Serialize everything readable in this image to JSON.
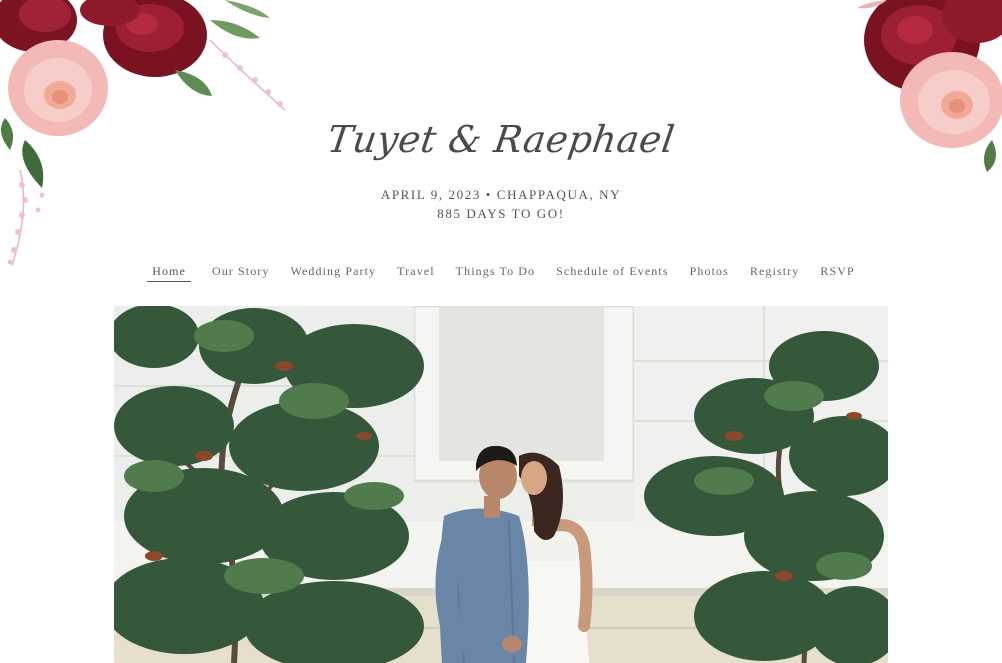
{
  "header": {
    "couple_names": "Tuyet & Raephael",
    "date_location": "APRIL 9, 2023 • CHAPPAQUA, NY",
    "countdown": "885 DAYS TO GO!"
  },
  "nav": {
    "items": [
      {
        "label": "Home",
        "active": true
      },
      {
        "label": "Our Story",
        "active": false
      },
      {
        "label": "Wedding Party",
        "active": false
      },
      {
        "label": "Travel",
        "active": false
      },
      {
        "label": "Things To Do",
        "active": false
      },
      {
        "label": "Schedule of Events",
        "active": false
      },
      {
        "label": "Photos",
        "active": false
      },
      {
        "label": "Registry",
        "active": false
      },
      {
        "label": "RSVP",
        "active": false
      }
    ]
  },
  "decor": {
    "left": "floral-corner-bouquet",
    "right": "floral-corner-bouquet"
  },
  "hero": {
    "subject": "couple-photo"
  },
  "colors": {
    "rose_red": "#8e1a2b",
    "blush": "#f4c6c4",
    "leaf": "#3f6b3a",
    "text": "#4a4a4a"
  }
}
